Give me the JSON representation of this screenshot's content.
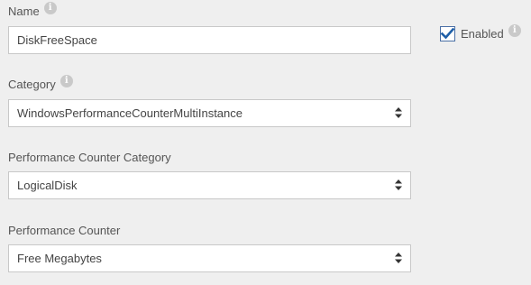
{
  "name": {
    "label": "Name",
    "value": "DiskFreeSpace"
  },
  "enabled": {
    "label": "Enabled",
    "checked": true
  },
  "category": {
    "label": "Category",
    "selected": "WindowsPerformanceCounterMultiInstance"
  },
  "perf_counter_category": {
    "label": "Performance Counter Category",
    "selected": "LogicalDisk"
  },
  "perf_counter": {
    "label": "Performance Counter",
    "selected": "Free Megabytes"
  },
  "icons": {
    "info": "info-icon",
    "check": "check-icon",
    "select_arrows": "select-arrows-icon"
  },
  "colors": {
    "background": "#efefef",
    "check_accent": "#1f5fa8",
    "info_icon": "#c9c9c9"
  }
}
